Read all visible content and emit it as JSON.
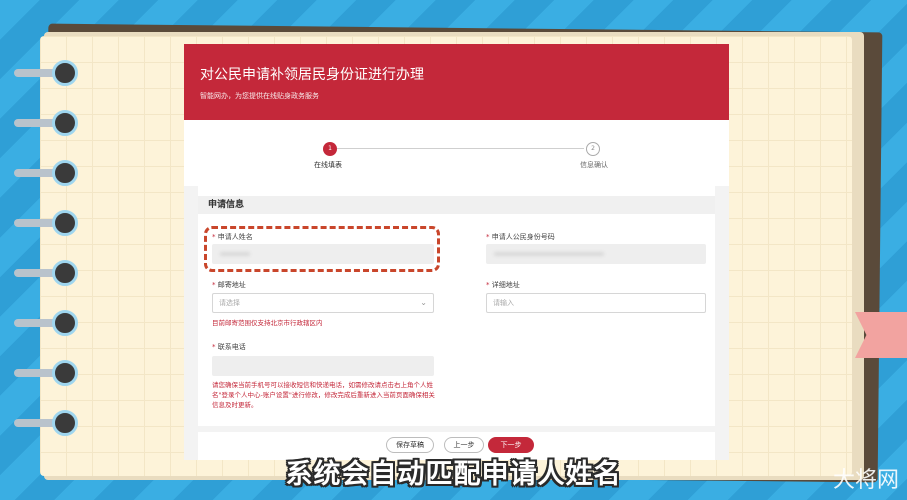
{
  "header": {
    "title": "对公民申请补领居民身份证进行办理",
    "subtitle": "智能网办，为您提供在线贴身政务服务"
  },
  "steps": [
    {
      "num": "1",
      "label": "在线填表"
    },
    {
      "num": "2",
      "label": "信息确认"
    }
  ],
  "form": {
    "section_title": "申请信息",
    "name_label": "申请人姓名",
    "id_label": "申请人公民身份号码",
    "mail_label": "邮寄地址",
    "mail_placeholder": "请选择",
    "mail_hint": "目前邮寄范围仅支持北京市行政辖区内",
    "detail_label": "详细地址",
    "detail_placeholder": "请输入",
    "phone_label": "联系电话",
    "phone_hint": "请您确保当前手机号可以接收短信和快递电话，如需修改请点击右上角个人姓名\"登录个人中心-账户设置\"进行修改，修改完成后重新进入当前页面确保相关信息及时更新。",
    "required_mark": "*"
  },
  "buttons": {
    "save": "保存草稿",
    "prev": "上一步",
    "next": "下一步"
  },
  "caption": "系统会自动匹配申请人姓名",
  "watermark": "大将网",
  "colors": {
    "accent": "#c4283a",
    "background": "#38a8de",
    "highlight": "#c9462b"
  }
}
